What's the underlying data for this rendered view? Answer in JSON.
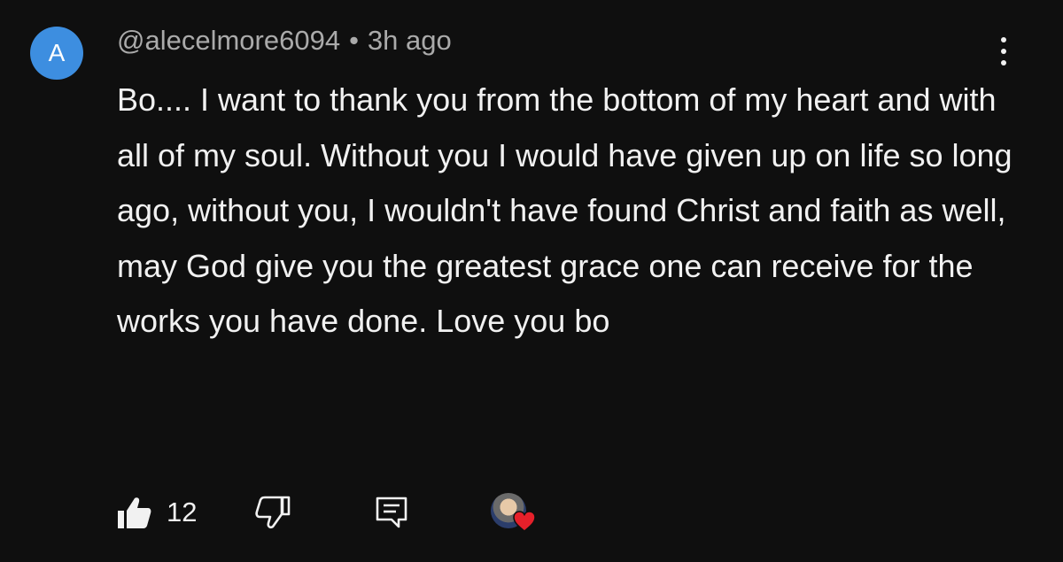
{
  "comment": {
    "avatar_letter": "A",
    "author": "@alecelmore6094",
    "separator": "•",
    "timestamp": "3h ago",
    "body": "Bo.... I want to thank you from the bottom of my heart and with all of my soul. Without you I would have given up on life so long ago, without you, I wouldn't have found Christ and faith as well, may God give you the greatest grace one can receive for the works you have done. Love you bo",
    "like_count": "12",
    "icons": {
      "like": "thumbs-up-icon",
      "dislike": "thumbs-down-icon",
      "reply": "comment-reply-icon",
      "menu": "more-vert-icon",
      "creator_heart": "heart-icon"
    },
    "colors": {
      "background": "#0f0f0f",
      "avatar": "#3d8ee0",
      "heart": "#e5202a",
      "secondary_text": "#aaaaaa"
    }
  }
}
